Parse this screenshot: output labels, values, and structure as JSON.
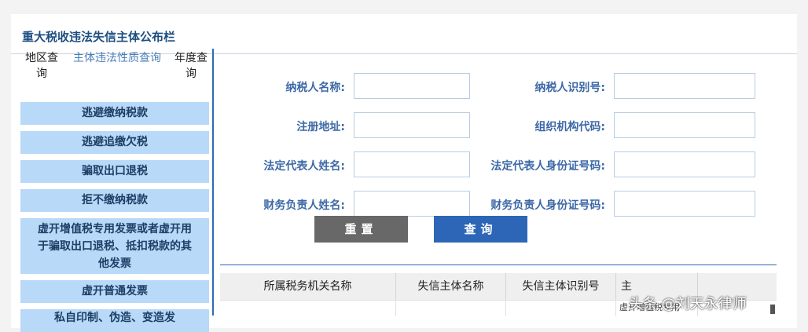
{
  "page_title": "重大税收违法失信主体公布栏",
  "tabs": [
    {
      "label": "地区查询",
      "active": false
    },
    {
      "label": "主体违法性质查询",
      "active": true
    },
    {
      "label": "年度查询",
      "active": false
    }
  ],
  "categories": [
    "逃避缴纳税款",
    "逃避追缴欠税",
    "骗取出口退税",
    "拒不缴纳税款",
    "虚开增值税专用发票或者虚开用于骗取出口退税、抵扣税款的其他发票",
    "虚开普通发票",
    "私自印制、伪造、变造发"
  ],
  "form": {
    "taxpayer_name_label": "纳税人名称:",
    "taxpayer_id_label": "纳税人识别号:",
    "address_label": "注册地址:",
    "org_code_label": "组织机构代码:",
    "legal_rep_name_label": "法定代表人姓名:",
    "legal_rep_id_label": "法定代表人身份证号码:",
    "finance_name_label": "财务负责人姓名:",
    "finance_id_label": "财务负责人身份证号码:"
  },
  "buttons": {
    "reset": "重置",
    "query": "查询"
  },
  "table": {
    "columns": [
      "所属税务机关名称",
      "失信主体名称",
      "失信主体识别号",
      "主"
    ],
    "partial_cell": "虚开增值税专用"
  },
  "watermark": "头条 @刘天永律师",
  "colors": {
    "accent": "#2d66b7",
    "menu_bg": "#b8d9f7",
    "label": "#3c68a6"
  }
}
